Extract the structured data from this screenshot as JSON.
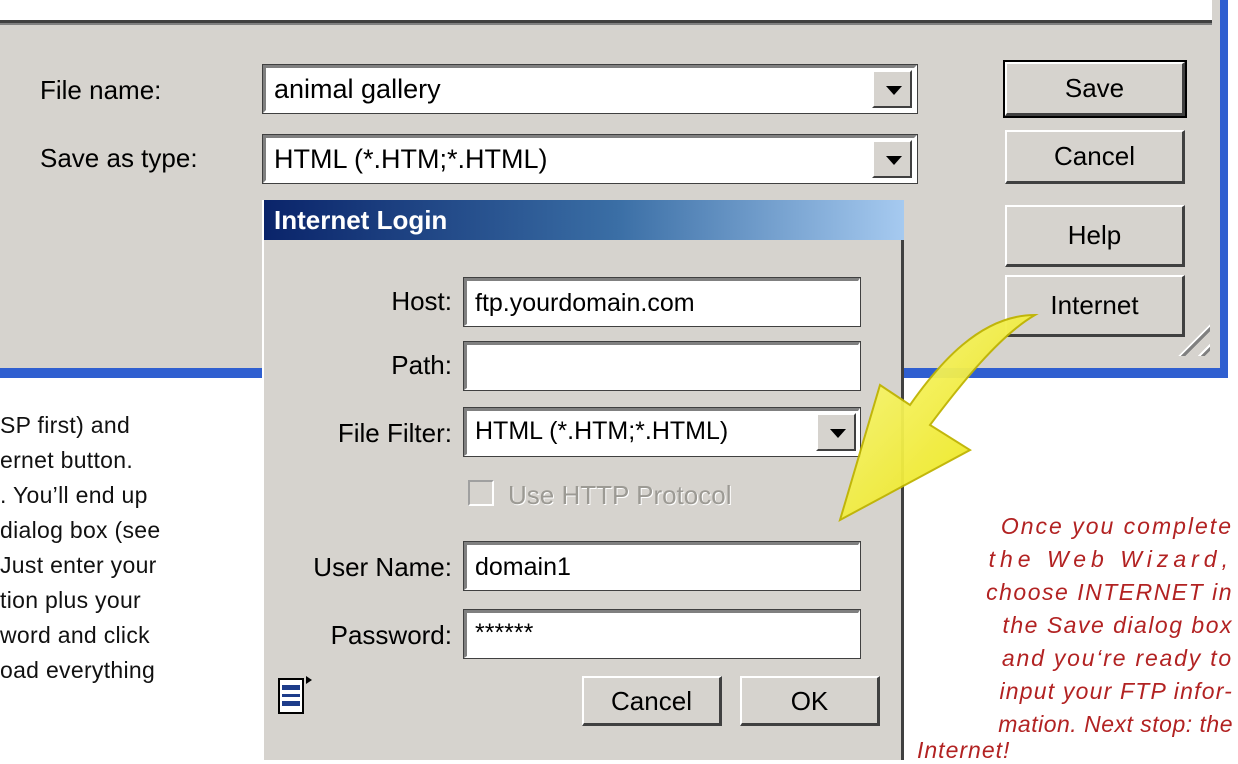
{
  "save_dialog": {
    "file_name_label": "File name:",
    "file_name_value": "animal gallery",
    "save_as_type_label": "Save as type:",
    "save_as_type_value": "HTML (*.HTM;*.HTML)",
    "buttons": {
      "save": "Save",
      "cancel": "Cancel",
      "help": "Help",
      "internet": "Internet"
    }
  },
  "login_dialog": {
    "title": "Internet Login",
    "host_label": "Host:",
    "host_value": "ftp.yourdomain.com",
    "path_label": "Path:",
    "path_value": "",
    "file_filter_label": "File Filter:",
    "file_filter_value": "HTML (*.HTM;*.HTML)",
    "use_http_label": "Use HTTP Protocol",
    "user_name_label": "User Name:",
    "user_name_value": "domain1",
    "password_label": "Password:",
    "password_value": "******",
    "cancel_label": "Cancel",
    "ok_label": "OK",
    "icon": "document-icon"
  },
  "left_text": [
    "SP first) and",
    "ernet button.",
    ". You’ll end up",
    "dialog box (see",
    "Just enter your",
    "tion plus your",
    "word and click",
    "oad everything"
  ],
  "caption_lines": [
    "Once you complete",
    "the Web Wizard,",
    "choose INTERNET in",
    "the Save dialog box",
    "and you‘re ready to",
    "input your FTP infor-",
    "mation. Next stop: the",
    "Internet!"
  ],
  "colors": {
    "dialog_bg": "#d6d3ce",
    "frame_blue": "#2f5fd0",
    "title_dark": "#0a246a",
    "arrow_yellow": "#f2ef1a",
    "caption_red": "#b22222"
  }
}
